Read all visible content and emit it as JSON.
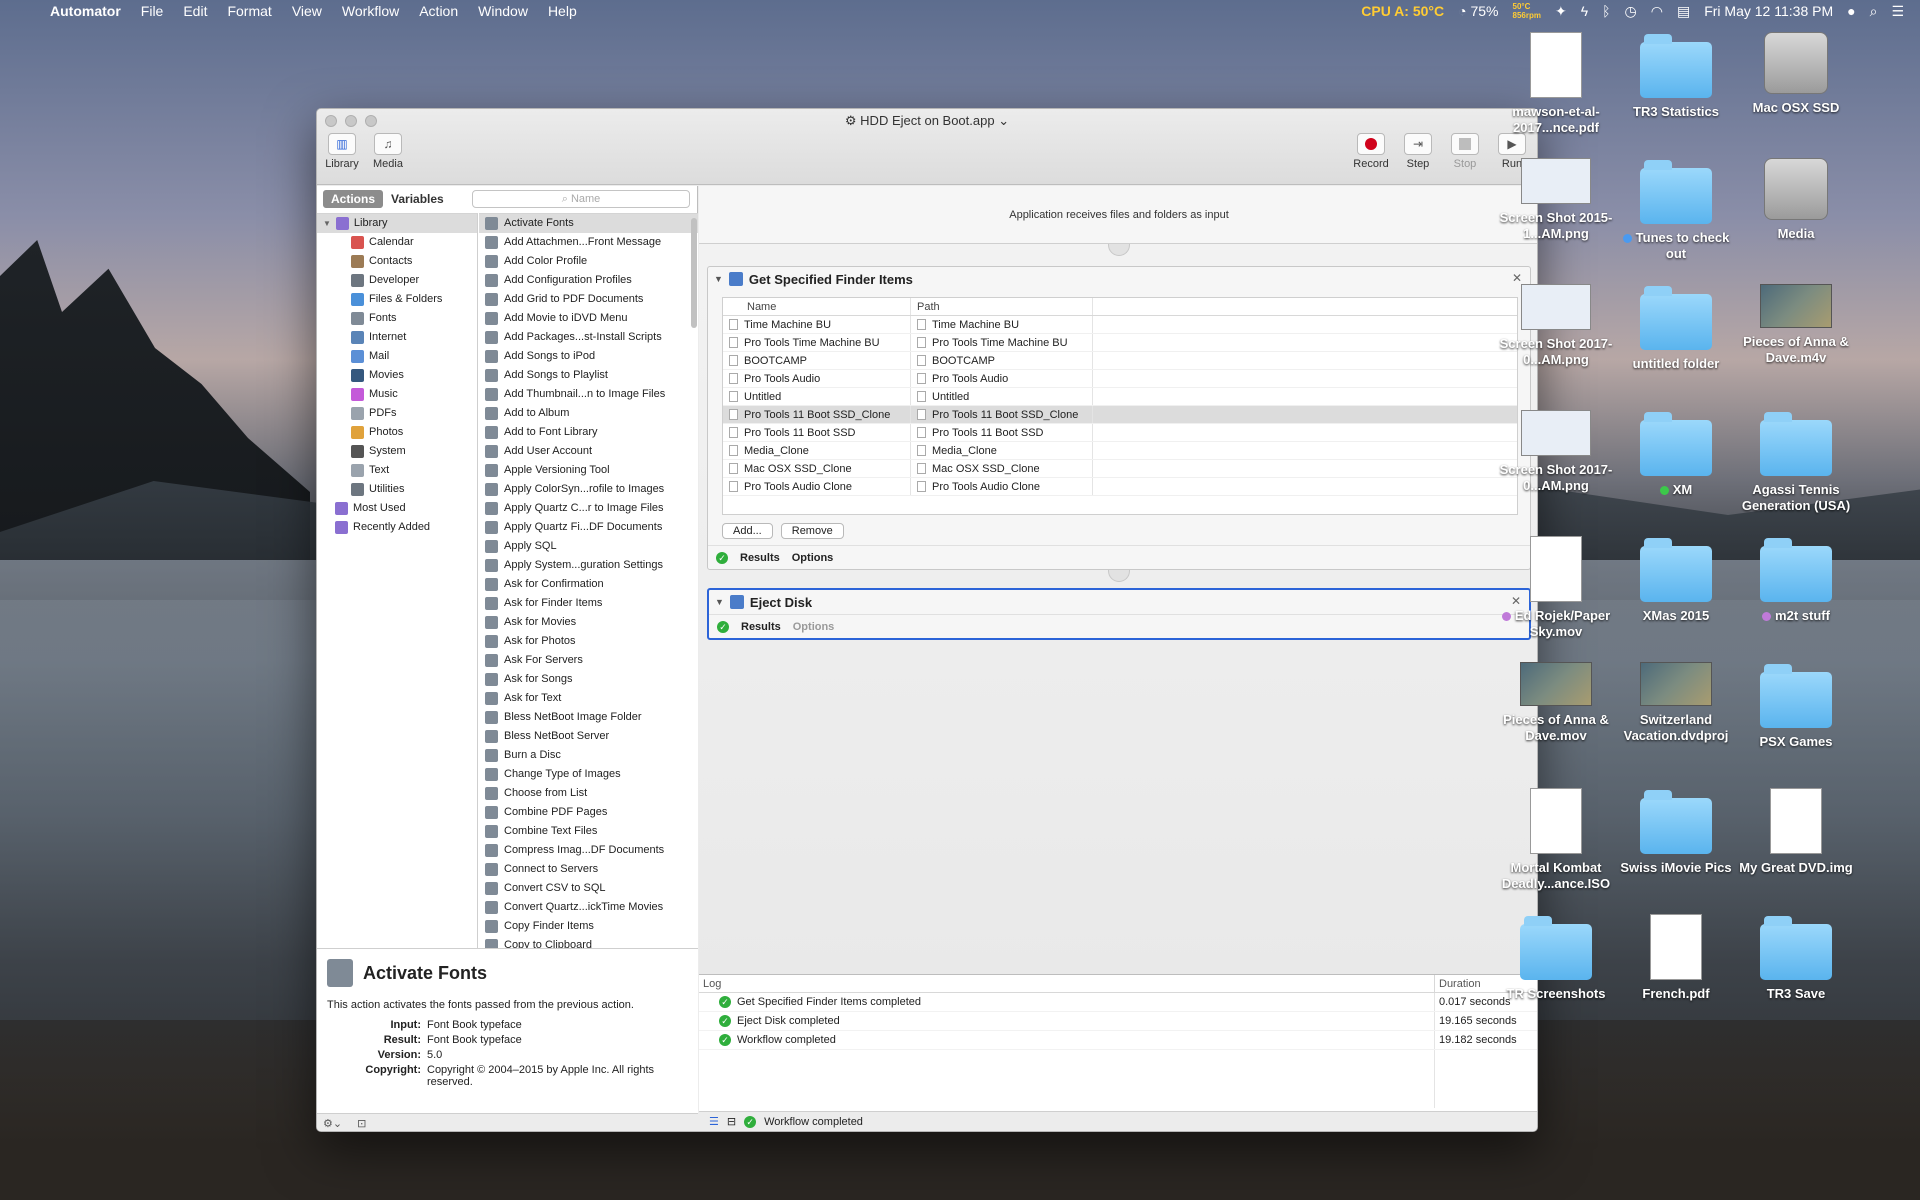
{
  "menubar": {
    "apple": "",
    "app": "Automator",
    "items": [
      "File",
      "Edit",
      "Format",
      "View",
      "Workflow",
      "Action",
      "Window",
      "Help"
    ],
    "cpu": "CPU A: 50°C",
    "fan_temp": "50°C",
    "fan_rpm": "856rpm",
    "battery": "75%",
    "datetime": "Fri May 12  11:38 PM"
  },
  "window": {
    "title": "HDD Eject on Boot.app",
    "toolbar": {
      "library": "Library",
      "media": "Media",
      "record": "Record",
      "step": "Step",
      "stop": "Stop",
      "run": "Run"
    }
  },
  "left": {
    "tab_actions": "Actions",
    "tab_variables": "Variables",
    "search_placeholder": "Name",
    "library": [
      {
        "label": "Library",
        "color": "#8a6fd1"
      },
      {
        "label": "Calendar",
        "color": "#d9534f"
      },
      {
        "label": "Contacts",
        "color": "#9c7b55"
      },
      {
        "label": "Developer",
        "color": "#6d7680"
      },
      {
        "label": "Files & Folders",
        "color": "#4a90d9"
      },
      {
        "label": "Fonts",
        "color": "#7f8a96"
      },
      {
        "label": "Internet",
        "color": "#5a84b7"
      },
      {
        "label": "Mail",
        "color": "#5b8fd6"
      },
      {
        "label": "Movies",
        "color": "#35587e"
      },
      {
        "label": "Music",
        "color": "#c45ad9"
      },
      {
        "label": "PDFs",
        "color": "#9aa3ad"
      },
      {
        "label": "Photos",
        "color": "#e0a23b"
      },
      {
        "label": "System",
        "color": "#555"
      },
      {
        "label": "Text",
        "color": "#9aa3ad"
      },
      {
        "label": "Utilities",
        "color": "#6d7680"
      },
      {
        "label": "Most Used",
        "color": "#8a6fd1"
      },
      {
        "label": "Recently Added",
        "color": "#8a6fd1"
      }
    ],
    "actions": [
      "Activate Fonts",
      "Add Attachmen...Front Message",
      "Add Color Profile",
      "Add Configuration Profiles",
      "Add Grid to PDF Documents",
      "Add Movie to iDVD Menu",
      "Add Packages...st-Install Scripts",
      "Add Songs to iPod",
      "Add Songs to Playlist",
      "Add Thumbnail...n to Image Files",
      "Add to Album",
      "Add to Font Library",
      "Add User Account",
      "Apple Versioning Tool",
      "Apply ColorSyn...rofile to Images",
      "Apply Quartz C...r to Image Files",
      "Apply Quartz Fi...DF Documents",
      "Apply SQL",
      "Apply System...guration Settings",
      "Ask for Confirmation",
      "Ask for Finder Items",
      "Ask for Movies",
      "Ask for Photos",
      "Ask For Servers",
      "Ask for Songs",
      "Ask for Text",
      "Bless NetBoot Image Folder",
      "Bless NetBoot Server",
      "Burn a Disc",
      "Change Type of Images",
      "Choose from List",
      "Combine PDF Pages",
      "Combine Text Files",
      "Compress Imag...DF Documents",
      "Connect to Servers",
      "Convert CSV to SQL",
      "Convert Quartz...ickTime Movies",
      "Copy Finder Items",
      "Copy to Clipboard"
    ],
    "description": {
      "title": "Activate Fonts",
      "text": "This action activates the fonts passed from the previous action.",
      "input_label": "Input:",
      "input": "Font Book typeface",
      "result_label": "Result:",
      "result": "Font Book typeface",
      "version_label": "Version:",
      "version": "5.0",
      "copyright_label": "Copyright:",
      "copyright": "Copyright © 2004–2015 by Apple Inc. All rights reserved."
    }
  },
  "workflow": {
    "input_text": "Application receives files and folders as input",
    "action1": {
      "title": "Get Specified Finder Items",
      "col_name": "Name",
      "col_path": "Path",
      "rows": [
        {
          "name": "Time Machine BU",
          "path": "Time Machine BU"
        },
        {
          "name": "Pro Tools Time Machine BU",
          "path": "Pro Tools Time Machine BU"
        },
        {
          "name": "BOOTCAMP",
          "path": "BOOTCAMP"
        },
        {
          "name": "Pro Tools Audio",
          "path": "Pro Tools Audio"
        },
        {
          "name": "Untitled",
          "path": "Untitled"
        },
        {
          "name": "Pro Tools 11 Boot SSD_Clone",
          "path": "Pro Tools 11 Boot SSD_Clone"
        },
        {
          "name": "Pro Tools 11 Boot SSD",
          "path": "Pro Tools 11 Boot SSD"
        },
        {
          "name": "Media_Clone",
          "path": "Media_Clone"
        },
        {
          "name": "Mac OSX SSD_Clone",
          "path": "Mac OSX SSD_Clone"
        },
        {
          "name": "Pro Tools Audio Clone",
          "path": "Pro Tools Audio Clone"
        }
      ],
      "add_btn": "Add...",
      "remove_btn": "Remove",
      "results": "Results",
      "options": "Options"
    },
    "action2": {
      "title": "Eject Disk",
      "results": "Results",
      "options": "Options"
    }
  },
  "log": {
    "col_log": "Log",
    "col_duration": "Duration",
    "rows": [
      {
        "text": "Get Specified Finder Items completed",
        "duration": "0.017 seconds"
      },
      {
        "text": "Eject Disk completed",
        "duration": "19.165 seconds"
      },
      {
        "text": "Workflow completed",
        "duration": "19.182 seconds"
      }
    ],
    "status": "Workflow completed"
  },
  "desktop": [
    {
      "label": "mawson-et-al-2017...nce.pdf",
      "kind": "doc"
    },
    {
      "label": "TR3 Statistics",
      "kind": "folder"
    },
    {
      "label": "Mac OSX SSD",
      "kind": "disk"
    },
    {
      "label": "Screen Shot 2015-1...AM.png",
      "kind": "shot"
    },
    {
      "label": "Tunes to check out",
      "kind": "folder",
      "tag": "#4a9af0"
    },
    {
      "label": "Media",
      "kind": "disk"
    },
    {
      "label": "Screen Shot 2017-0...AM.png",
      "kind": "shot"
    },
    {
      "label": "untitled folder",
      "kind": "folder"
    },
    {
      "label": "Pieces of Anna & Dave.m4v",
      "kind": "thumb"
    },
    {
      "label": "Screen Shot 2017-0...AM.png",
      "kind": "shot"
    },
    {
      "label": "XM",
      "kind": "folder",
      "tag": "#3cc94a"
    },
    {
      "label": "Agassi Tennis Generation (USA)",
      "kind": "folder"
    },
    {
      "label": "Ed Rojek/Paper Sky.mov",
      "kind": "doc",
      "tag": "#c07ad9"
    },
    {
      "label": "XMas 2015",
      "kind": "folder"
    },
    {
      "label": "m2t stuff",
      "kind": "folder",
      "tag": "#c07ad9"
    },
    {
      "label": "Pieces of Anna & Dave.mov",
      "kind": "thumb"
    },
    {
      "label": "Switzerland Vacation.dvdproj",
      "kind": "thumb"
    },
    {
      "label": "PSX Games",
      "kind": "folder"
    },
    {
      "label": "Mortal Kombat Deadly...ance.ISO",
      "kind": "doc"
    },
    {
      "label": "Swiss iMovie Pics",
      "kind": "folder"
    },
    {
      "label": "My Great DVD.img",
      "kind": "doc"
    },
    {
      "label": "TR Screenshots",
      "kind": "folder"
    },
    {
      "label": "French.pdf",
      "kind": "doc"
    },
    {
      "label": "TR3 Save",
      "kind": "folder"
    }
  ]
}
